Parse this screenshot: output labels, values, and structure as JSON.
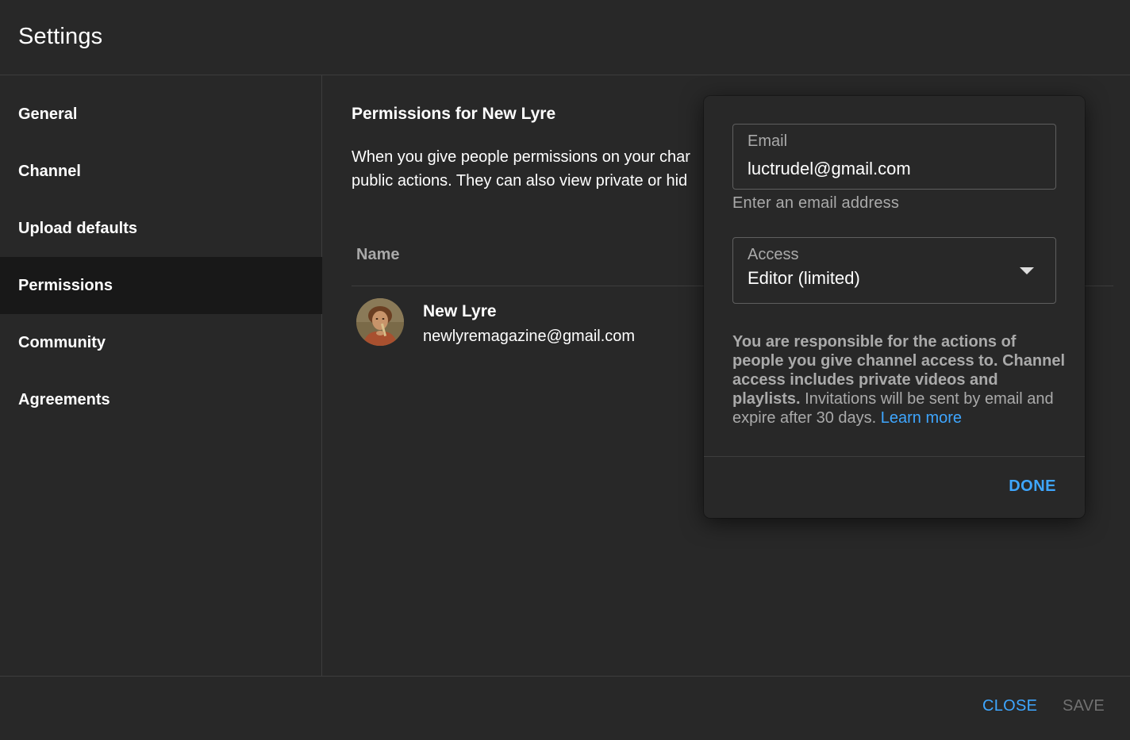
{
  "header": {
    "title": "Settings"
  },
  "sidebar": {
    "items": [
      {
        "label": "General"
      },
      {
        "label": "Channel"
      },
      {
        "label": "Upload defaults"
      },
      {
        "label": "Permissions",
        "active": true
      },
      {
        "label": "Community"
      },
      {
        "label": "Agreements"
      }
    ]
  },
  "permissions": {
    "title": "Permissions for New Lyre",
    "description_line1": "When you give people permissions on your char",
    "description_line2": "public actions. They can also view private or hid",
    "column_name": "Name",
    "users": [
      {
        "name": "New Lyre",
        "email": "newlyremagazine@gmail.com",
        "avatar": "portrait-avatar"
      }
    ]
  },
  "invite_dialog": {
    "email_label": "Email",
    "email_value": "luctrudel@gmail.com",
    "email_helper": "Enter an email address",
    "access_label": "Access",
    "access_value": "Editor (limited)",
    "notice_bold": "You are responsible for the actions of people you give channel access to. Channel access includes private videos and playlists.",
    "notice_text": " Invitations will be sent by email and expire after 30 days. ",
    "learn_more": "Learn more",
    "done_label": "DONE"
  },
  "footer": {
    "close_label": "CLOSE",
    "save_label": "SAVE"
  },
  "colors": {
    "accent": "#3ea6ff",
    "background": "#282828",
    "active_nav": "#181818",
    "muted_text": "#aaaaaa"
  }
}
